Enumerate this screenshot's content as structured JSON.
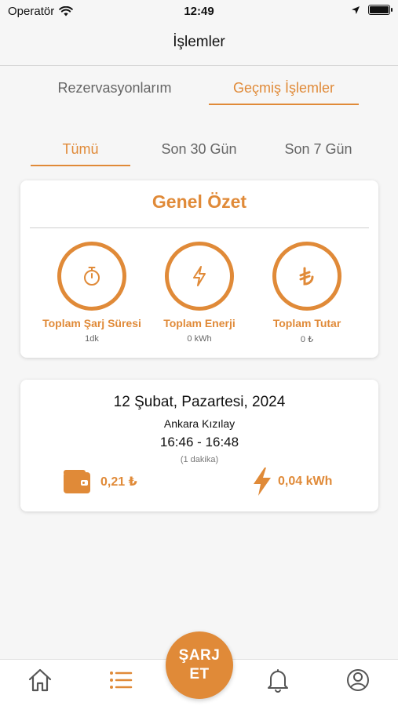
{
  "status_bar": {
    "carrier": "Operatör",
    "time": "12:49"
  },
  "nav": {
    "title": "İşlemler"
  },
  "top_tabs": [
    {
      "label": "Rezervasyonlarım",
      "active": false
    },
    {
      "label": "Geçmiş İşlemler",
      "active": true
    }
  ],
  "filter_tabs": [
    {
      "label": "Tümü",
      "active": true
    },
    {
      "label": "Son 30 Gün",
      "active": false
    },
    {
      "label": "Son 7 Gün",
      "active": false
    }
  ],
  "summary": {
    "title": "Genel Özet",
    "stats": [
      {
        "icon": "stopwatch-icon",
        "label": "Toplam Şarj Süresi",
        "value": "1dk"
      },
      {
        "icon": "lightning-icon",
        "label": "Toplam Enerji",
        "value": "0 kWh"
      },
      {
        "icon": "lira-icon",
        "label": "Toplam Tutar",
        "value": "0 ₺"
      }
    ]
  },
  "transaction": {
    "date": "12 Şubat, Pazartesi, 2024",
    "location": "Ankara Kızılay",
    "time_range": "16:46 - 16:48",
    "duration": "(1 dakika)",
    "cost": "0,21 ₺",
    "energy": "0,04 kWh"
  },
  "tab_bar": {
    "charge_line1": "ŞARJ",
    "charge_line2": "ET",
    "items": [
      "home-icon",
      "list-icon",
      "bell-icon",
      "profile-icon"
    ]
  },
  "colors": {
    "accent": "#e08a38",
    "background": "#f6f6f6"
  }
}
